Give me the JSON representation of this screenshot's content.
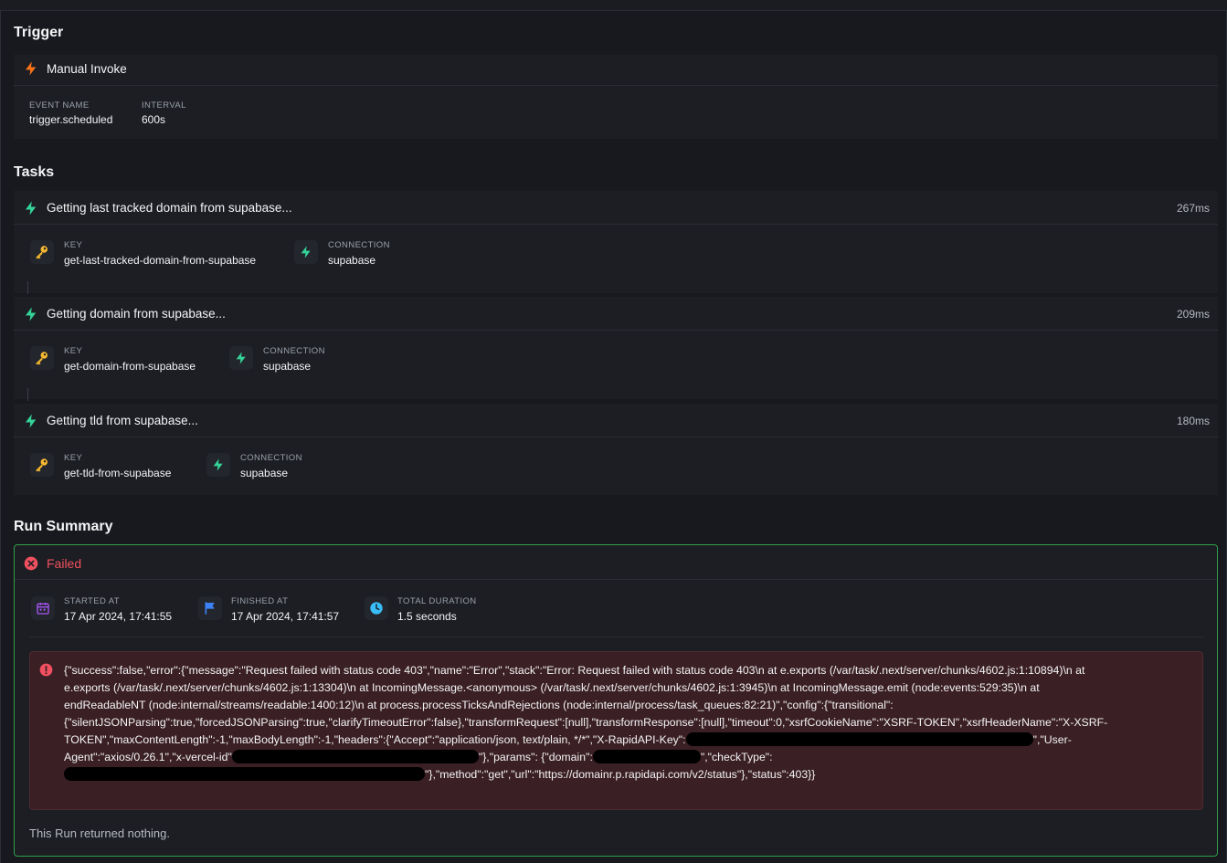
{
  "trigger": {
    "section_title": "Trigger",
    "name": "Manual Invoke",
    "event_name_label": "EVENT NAME",
    "event_name_value": "trigger.scheduled",
    "interval_label": "INTERVAL",
    "interval_value": "600s"
  },
  "tasks": {
    "section_title": "Tasks",
    "items": [
      {
        "title": "Getting last tracked domain from supabase...",
        "duration": "267ms",
        "key_label": "KEY",
        "key_value": "get-last-tracked-domain-from-supabase",
        "connection_label": "CONNECTION",
        "connection_value": "supabase"
      },
      {
        "title": "Getting domain from supabase...",
        "duration": "209ms",
        "key_label": "KEY",
        "key_value": "get-domain-from-supabase",
        "connection_label": "CONNECTION",
        "connection_value": "supabase"
      },
      {
        "title": "Getting tld from supabase...",
        "duration": "180ms",
        "key_label": "KEY",
        "key_value": "get-tld-from-supabase",
        "connection_label": "CONNECTION",
        "connection_value": "supabase"
      }
    ]
  },
  "run_summary": {
    "section_title": "Run Summary",
    "status": "Failed",
    "started_label": "STARTED AT",
    "started_value": "17 Apr 2024, 17:41:55",
    "finished_label": "FINISHED AT",
    "finished_value": "17 Apr 2024, 17:41:57",
    "duration_label": "TOTAL DURATION",
    "duration_value": "1.5 seconds",
    "error_part_1": "{\"success\":false,\"error\":{\"message\":\"Request failed with status code 403\",\"name\":\"Error\",\"stack\":\"Error: Request failed with status code 403\\n at e.exports (/var/task/.next/server/chunks/4602.js:1:10894)\\n at e.exports (/var/task/.next/server/chunks/4602.js:1:13304)\\n at IncomingMessage.<anonymous> (/var/task/.next/server/chunks/4602.js:1:3945)\\n at IncomingMessage.emit (node:events:529:35)\\n at endReadableNT (node:internal/streams/readable:1400:12)\\n at process.processTicksAndRejections (node:internal/process/task_queues:82:21)\",\"config\":{\"transitional\": {\"silentJSONParsing\":true,\"forcedJSONParsing\":true,\"clarifyTimeoutError\":false},\"transformRequest\":[null],\"transformResponse\":[null],\"timeout\":0,\"xsrfCookieName\":\"XSRF-TOKEN\",\"xsrfHeaderName\":\"X-XSRF-TOKEN\",\"maxContentLength\":-1,\"maxBodyLength\":-1,\"headers\":{\"Accept\":\"application/json, text/plain, */*\",\"X-RapidAPI-Key\":",
    "error_part_2": "\",\"User-Agent\":\"axios/0.26.1\",\"x-vercel-id\"",
    "error_part_3": "\"},\"params\": {\"domain\":",
    "error_part_4": "\",\"checkType\":",
    "error_part_5": "\"},\"method\":\"get\",\"url\":\"https://domainr.p.rapidapi.com/v2/status\"},\"status\":403}}",
    "returned": "This Run returned nothing."
  },
  "colors": {
    "task_icon": "#34d399",
    "trigger_icon": "#f97316",
    "key_icon": "#f5b82e",
    "failed": "#f0505f",
    "summary_border": "#2f9e4a",
    "calendar_icon": "#a855f7",
    "flag_icon": "#3b82f6",
    "clock_icon": "#38bdf8"
  }
}
